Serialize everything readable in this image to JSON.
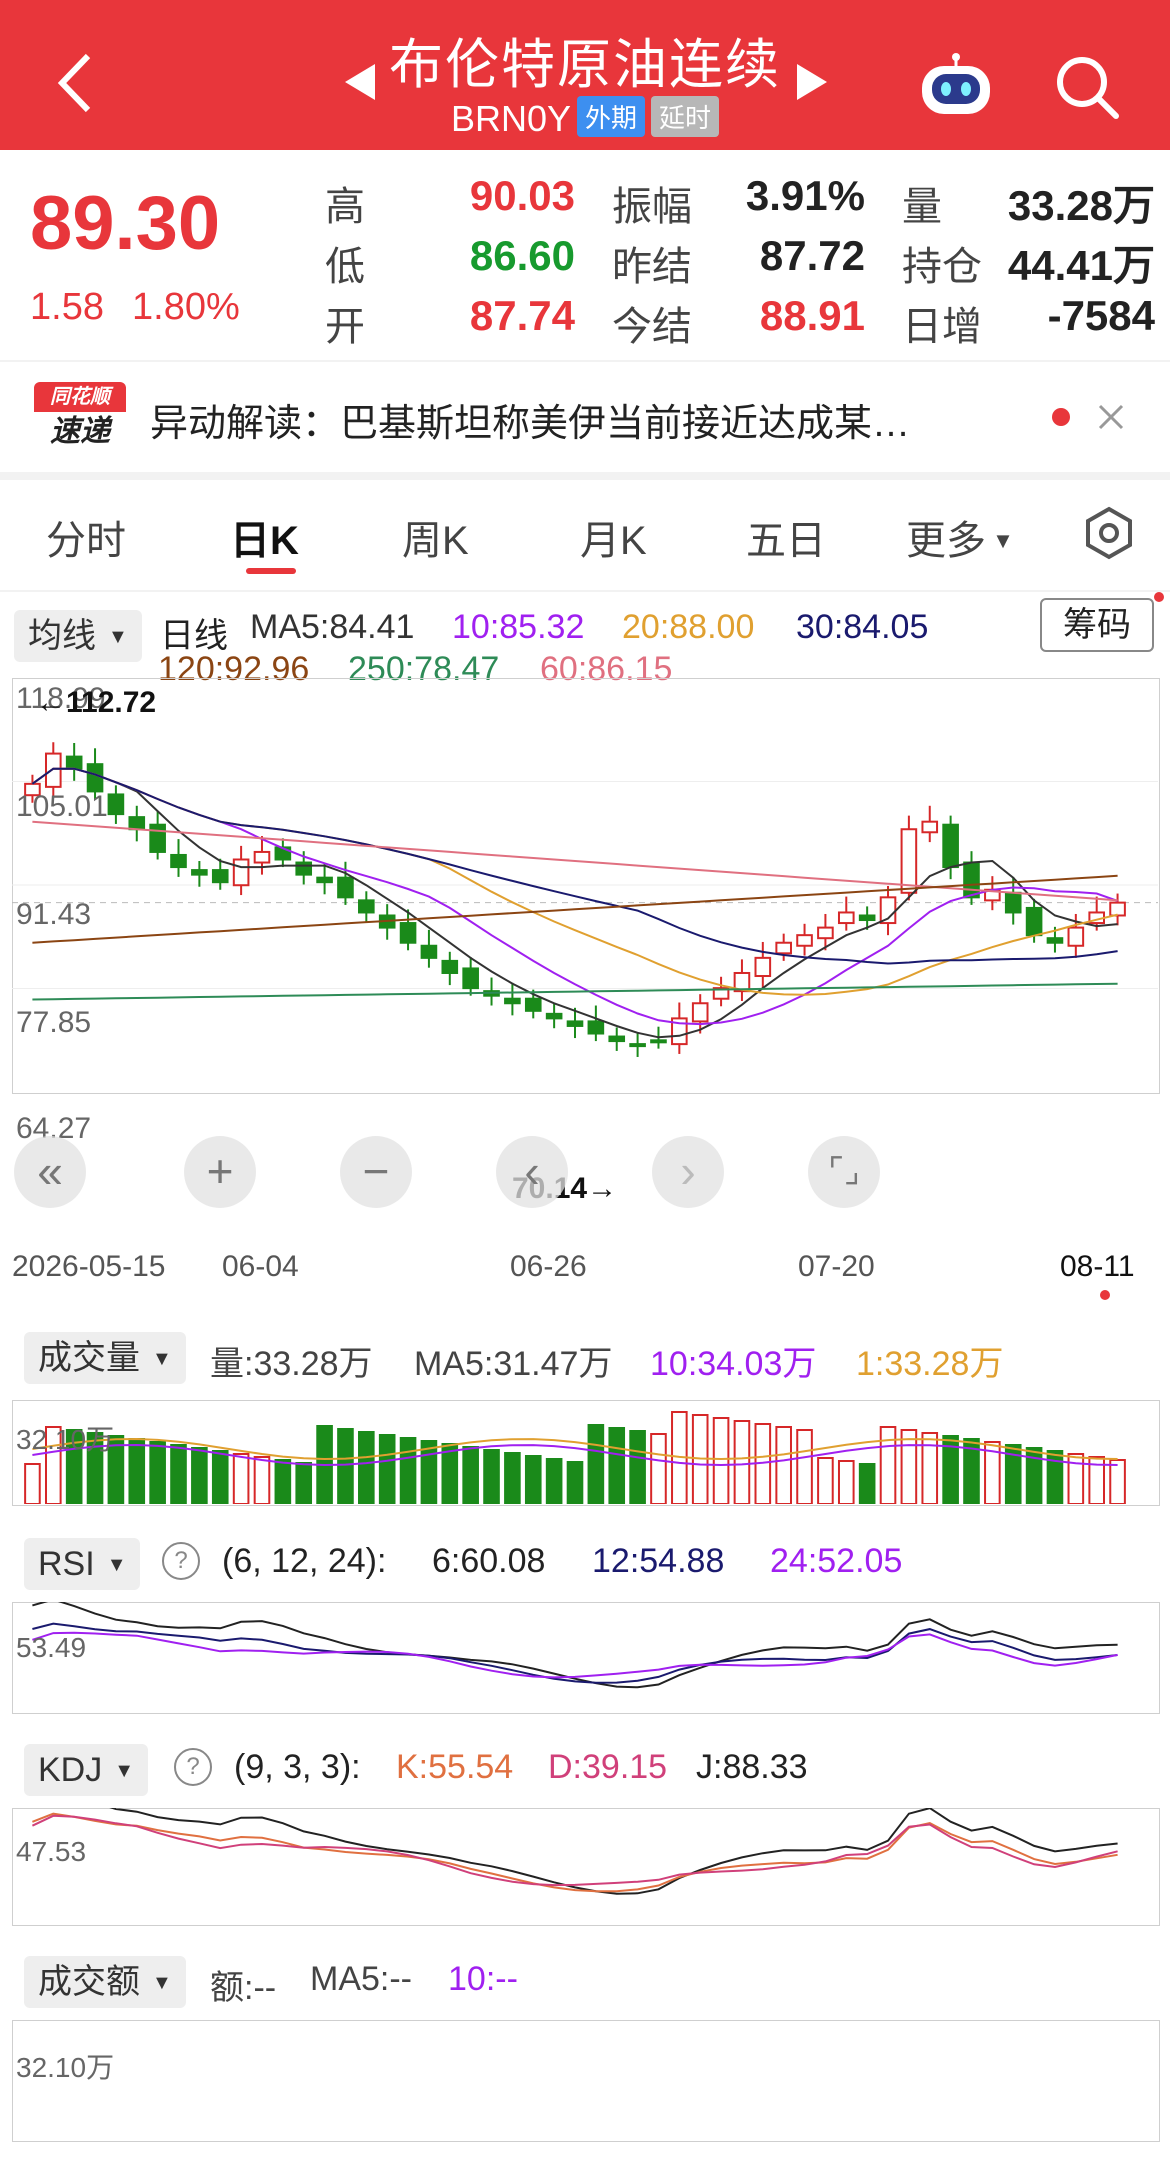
{
  "header": {
    "title": "布伦特原油连续",
    "code": "BRN0Y",
    "tag_market": "外期",
    "tag_delay": "延时",
    "colors": {
      "bar": "#e8363b"
    }
  },
  "quote": {
    "price": "89.30",
    "change": "1.58",
    "change_pct": "1.80%",
    "high_label": "高",
    "high": "90.03",
    "low_label": "低",
    "low": "86.60",
    "open_label": "开",
    "open": "87.74",
    "amp_label": "振幅",
    "amp": "3.91%",
    "prev_settle_label": "昨结",
    "prev_settle": "87.72",
    "settle_label": "今结",
    "settle": "88.91",
    "vol_label": "量",
    "vol": "33.28万",
    "oi_label": "持仓",
    "oi": "44.41万",
    "oi_change_label": "日增",
    "oi_change": "-7584"
  },
  "news": {
    "logo_top": "同花顺",
    "logo_bottom": "速递",
    "text": "异动解读：巴基斯坦称美伊当前接近达成某…"
  },
  "tabs": [
    "分时",
    "日K",
    "周K",
    "月K",
    "五日",
    "更多"
  ],
  "active_tab": "日K",
  "kline": {
    "ma_dropdown": "均线",
    "period": "日线",
    "ma5": "MA5:84.41",
    "ma10": "10:85.32",
    "ma20": "20:88.00",
    "ma30": "30:84.05",
    "ma120": "120:92.96",
    "ma250": "250:78.47",
    "ma60": "60:86.15",
    "chip_button": "筹码",
    "y_labels": [
      "118.99",
      "105.01",
      "91.43",
      "77.85",
      "64.27"
    ],
    "max_label": "←112.72",
    "min_label": "70.14→",
    "dates": [
      "2026-05-15",
      "06-04",
      "06-26",
      "07-20",
      "08-11"
    ],
    "ma_colors": {
      "ma5": "#333333",
      "ma10": "#a020f0",
      "ma20": "#e0a030",
      "ma30": "#1a1a6e",
      "ma120": "#8b4513",
      "ma250": "#2e8b57",
      "ma60": "#e07080"
    }
  },
  "volume": {
    "dropdown": "成交量",
    "vol": "量:33.28万",
    "ma5": "MA5:31.47万",
    "ma10": "10:34.03万",
    "ma1": "1:33.28万",
    "y_label": "32.10万"
  },
  "rsi": {
    "dropdown": "RSI",
    "params": "(6, 12, 24):",
    "r6": "6:60.08",
    "r12": "12:54.88",
    "r24": "24:52.05",
    "y_label": "53.49"
  },
  "kdj": {
    "dropdown": "KDJ",
    "params": "(9, 3, 3):",
    "k": "K:55.54",
    "d": "D:39.15",
    "j": "J:88.33",
    "y_label": "47.53"
  },
  "turnover": {
    "dropdown": "成交额",
    "amount": "额:--",
    "ma5": "MA5:--",
    "ma10": "10:--",
    "y_label": "32.10万"
  },
  "chart_data": {
    "type": "candlestick",
    "title": "布伦特原油连续 日线",
    "x": [
      "2026-05-15",
      "06-04",
      "06-26",
      "07-20",
      "08-11"
    ],
    "ylim": [
      64.27,
      118.99
    ],
    "last_close": 89.3,
    "period_high": 112.72,
    "period_low": 70.14,
    "closes_approx": [
      105,
      109,
      107,
      104,
      101,
      99,
      96,
      94,
      93,
      92,
      95,
      96,
      95,
      93,
      92,
      90,
      88,
      86,
      84,
      82,
      80,
      78,
      77,
      76,
      75,
      74,
      73,
      72,
      71,
      70.5,
      71,
      74,
      76,
      78,
      80,
      82,
      84,
      85,
      86,
      88,
      87,
      90,
      99,
      100,
      94,
      90,
      91,
      88,
      85,
      84,
      86,
      88,
      89.3
    ]
  }
}
